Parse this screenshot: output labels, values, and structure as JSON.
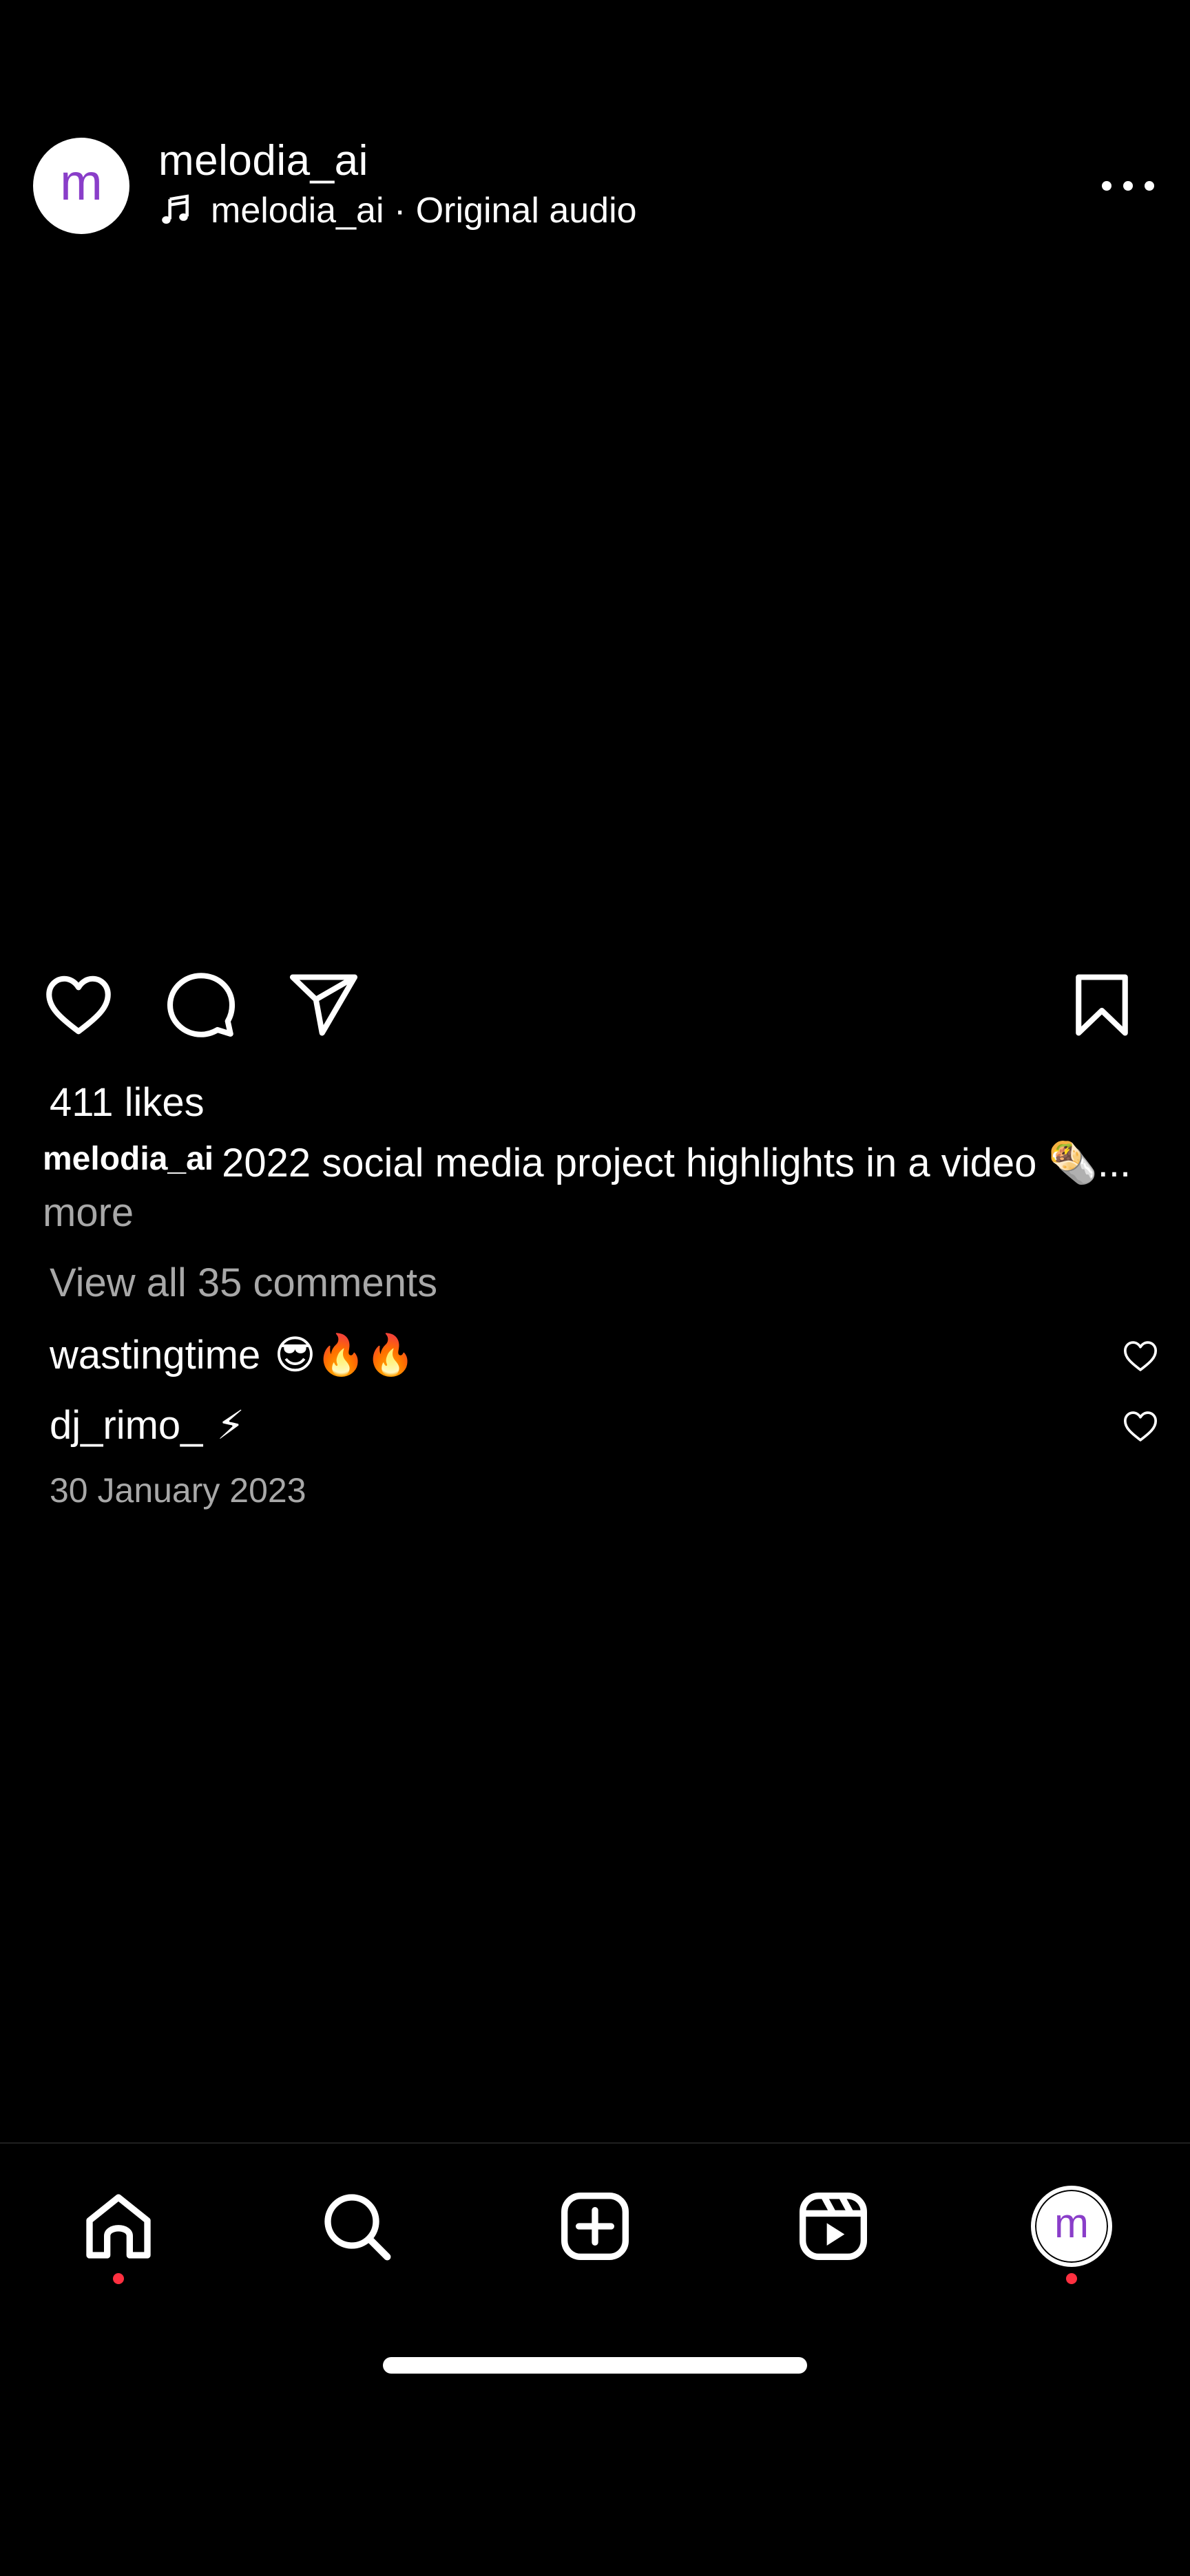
{
  "post": {
    "username": "melodia_ai",
    "avatar_letter": "m",
    "audio_label": "melodia_ai · Original audio",
    "more_icon": "more-horizontal-icon"
  },
  "actions": {
    "like_icon": "heart-outline-icon",
    "comment_icon": "comment-bubble-icon",
    "share_icon": "paper-plane-icon",
    "save_icon": "bookmark-icon"
  },
  "likes": "411 likes",
  "caption": {
    "user": "melodia_ai",
    "text": "2022 social media project highlights in a video 🌯",
    "ellipsis": "... ",
    "more": "more"
  },
  "view_comments": "View all 35 comments",
  "comments": [
    {
      "user": "wastingtime",
      "text": "😎🔥🔥"
    },
    {
      "user": "dj_rimo_",
      "text": "⚡"
    }
  ],
  "date": "30 January 2023",
  "tabbar": {
    "items": [
      "home-icon",
      "search-icon",
      "create-post-icon",
      "reels-icon",
      "profile-avatar"
    ],
    "avatar_letter": "m",
    "notification_color": "#ff3040"
  },
  "colors": {
    "background": "#000000",
    "text": "#ffffff",
    "secondary_text": "#a8a8a8",
    "avatar_letter": "#8a3ec9"
  }
}
